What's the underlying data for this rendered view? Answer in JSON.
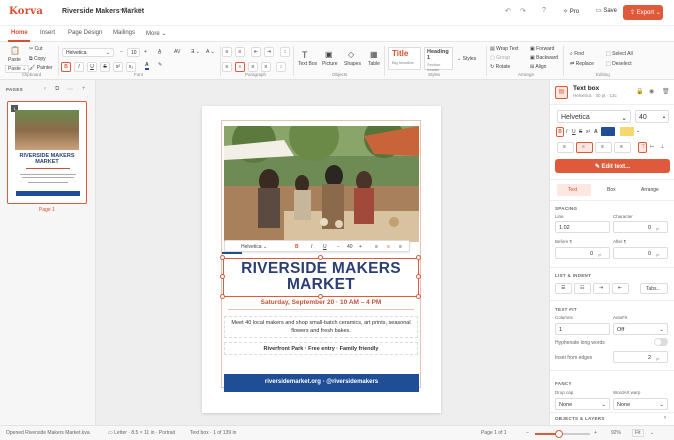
{
  "app": {
    "name": "Korva",
    "document_title": "Riverside Makers Market",
    "save_state": "• Saved"
  },
  "topbar": {
    "help": "?",
    "pro_label": "Pro",
    "save_label": "Save",
    "export_label": "Export"
  },
  "tabs": [
    "Home",
    "Insert",
    "Page Design",
    "Mailings",
    "More"
  ],
  "ribbon": {
    "clipboard": {
      "paste": "Paste",
      "paste_menu": "Paste ⌄",
      "cut": "Cut",
      "copy": "Copy",
      "painter": "Painter",
      "group": "Clipboard"
    },
    "font": {
      "family": "Helvetica",
      "size": "10",
      "group": "Font",
      "buttons": [
        "B",
        "I",
        "U",
        "S",
        "x²",
        "x₂"
      ]
    },
    "paragraph": {
      "group": "Paragraph"
    },
    "objects": {
      "text_box": "Text Box",
      "picture": "Picture",
      "shapes": "Shapes",
      "table": "Table",
      "group": "Objects"
    },
    "styles": {
      "title": "Title",
      "title_sub": "Big headline",
      "heading": "Heading 1",
      "heading_sub": "Section header",
      "styles_btn": "Styles",
      "group": "Styles"
    },
    "arrange": {
      "wrap": "Wrap Text",
      "group_lbl": "Group",
      "rotate": "Rotate",
      "forward": "Forward",
      "backward": "Backward",
      "align": "Align",
      "group": "Arrange"
    },
    "editing": {
      "find": "Find",
      "replace": "Replace",
      "select_all": "Select All",
      "deselect": "Deselect",
      "group": "Editing"
    }
  },
  "pages_panel": {
    "title": "PAGES",
    "page_label": "Page 1",
    "thumb_title": "RIVERSIDE MAKERS MARKET"
  },
  "document": {
    "headline": "RIVERSIDE MAKERS MARKET",
    "date_line": "Saturday, September 20 · 10 AM – 4 PM",
    "description": "Meet 40 local makers and shop small-batch ceramics, art prints, seasonal flowers and fresh bakes.",
    "location": "Riverfront Park · Free entry · Family friendly",
    "footer": "riversidemarket.org · @riversidemakers",
    "floating_toolbar": {
      "font": "Helvetica",
      "size": "40"
    }
  },
  "inspector": {
    "title": "Text box",
    "subtitle": "Helvetica · 40 pt · 13c",
    "font": "Helvetica",
    "size": "40",
    "text_color": "#1f4e96",
    "highlight_color": "#f5d76e",
    "edit_text": "Edit text...",
    "tabs": [
      "Text",
      "Box",
      "Arrange"
    ],
    "spacing": {
      "section": "SPACING",
      "line_lbl": "Line",
      "line": "1.02",
      "char_lbl": "Character",
      "char": "0",
      "char_unit": "pt",
      "before_lbl": "Before ¶",
      "before": "0",
      "before_unit": "pt",
      "after_lbl": "After ¶",
      "after": "0",
      "after_unit": "pt"
    },
    "list": {
      "section": "LIST & INDENT",
      "tabs_btn": "Tabs..."
    },
    "textfit": {
      "section": "TEXT FIT",
      "columns_lbl": "Columns",
      "columns": "1",
      "autofit_lbl": "AutoFit",
      "autofit": "Off",
      "hyphenate": "Hyphenate long words",
      "inset_lbl": "Inset from edges",
      "inset": "2",
      "inset_unit": "pt"
    },
    "fancy": {
      "section": "FANCY",
      "dropcap_lbl": "Drop cap",
      "dropcap": "None",
      "wordart_lbl": "WordArt warp",
      "wordart": "None"
    },
    "objects_layers": "OBJECTS & LAYERS"
  },
  "status": {
    "opened": "Opened Riverside Makers Market.kva",
    "page_size": "Letter · 8.5 × 11 in · Portrait",
    "selection": "Text box · 1 of 139 in",
    "page_of": "Page 1 of 1",
    "zoom": "92%",
    "fit": "Fit"
  },
  "colors": {
    "accent": "#de5a3a",
    "navy": "#1f4e96",
    "headline": "#2b3f73",
    "date": "#c0533a"
  }
}
